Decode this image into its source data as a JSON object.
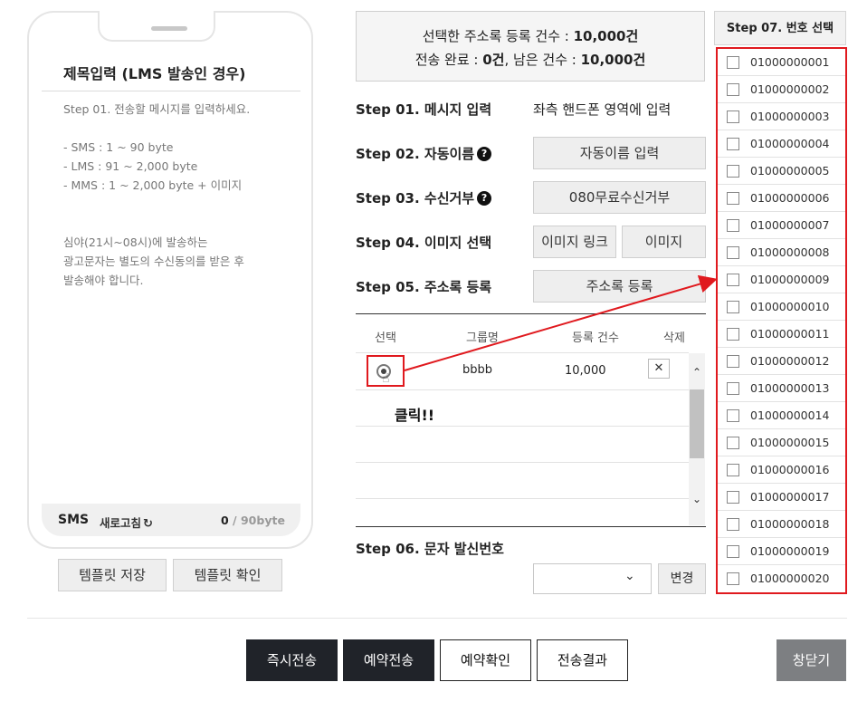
{
  "phone": {
    "title": "제목입력 (LMS 발송인 경우)",
    "message": "Step 01. 전송할 메시지를 입력하세요.\n\n- SMS : 1 ~ 90 byte\n- LMS : 91 ~ 2,000 byte\n- MMS : 1 ~ 2,000 byte + 이미지\n\n\n심야(21시~08시)에 발송하는\n광고문자는 별도의 수신동의를 받은 후\n발송해야 합니다.",
    "type": "SMS",
    "refresh": "새로고침",
    "bytes": "0",
    "limit": " / 90byte"
  },
  "template": {
    "save": "템플릿 저장",
    "check": "템플릿 확인"
  },
  "summary": {
    "line1_prefix": "선택한 주소록 등록 건수 : ",
    "line1_value": "10,000건",
    "line2_prefix": "전송 완료 : ",
    "line2_value": "0건",
    "line2_mid": ", 남은 건수 : ",
    "line2_value2": "10,000건"
  },
  "steps": {
    "s1": "Step 01. 메시지 입력",
    "s1_desc": "좌측 핸드폰 영역에 입력",
    "s2": "Step 02. 자동이름",
    "s2_btn": "자동이름 입력",
    "s3": "Step 03. 수신거부",
    "s3_btn": "080무료수신거부",
    "s4": "Step 04. 이미지 선택",
    "s4_btn1": "이미지 링크",
    "s4_btn2": "이미지",
    "s5": "Step 05. 주소록 등록",
    "s5_btn": "주소록 등록",
    "s6": "Step 06. 문자 발신번호",
    "s6_change": "변경",
    "help": "?"
  },
  "group_table": {
    "headers": [
      "선택",
      "그룹명",
      "등록 건수",
      "삭제"
    ],
    "rows": [
      {
        "name": "bbbb",
        "count": "10,000"
      }
    ],
    "delete": "✕",
    "click_note": "클릭!!"
  },
  "number_panel": {
    "title": "Step 07. 번호 선택",
    "numbers": [
      "01000000001",
      "01000000002",
      "01000000003",
      "01000000004",
      "01000000005",
      "01000000006",
      "01000000007",
      "01000000008",
      "01000000009",
      "01000000010",
      "01000000011",
      "01000000012",
      "01000000013",
      "01000000014",
      "01000000015",
      "01000000016",
      "01000000017",
      "01000000018",
      "01000000019",
      "01000000020"
    ]
  },
  "actions": {
    "send_now": "즉시전송",
    "reserve": "예약전송",
    "reserve_check": "예약확인",
    "result": "전송결과",
    "close": "창닫기"
  },
  "colors": {
    "highlight": "#e0191e",
    "dark_button": "#202329",
    "close_button": "#7d7f82"
  }
}
